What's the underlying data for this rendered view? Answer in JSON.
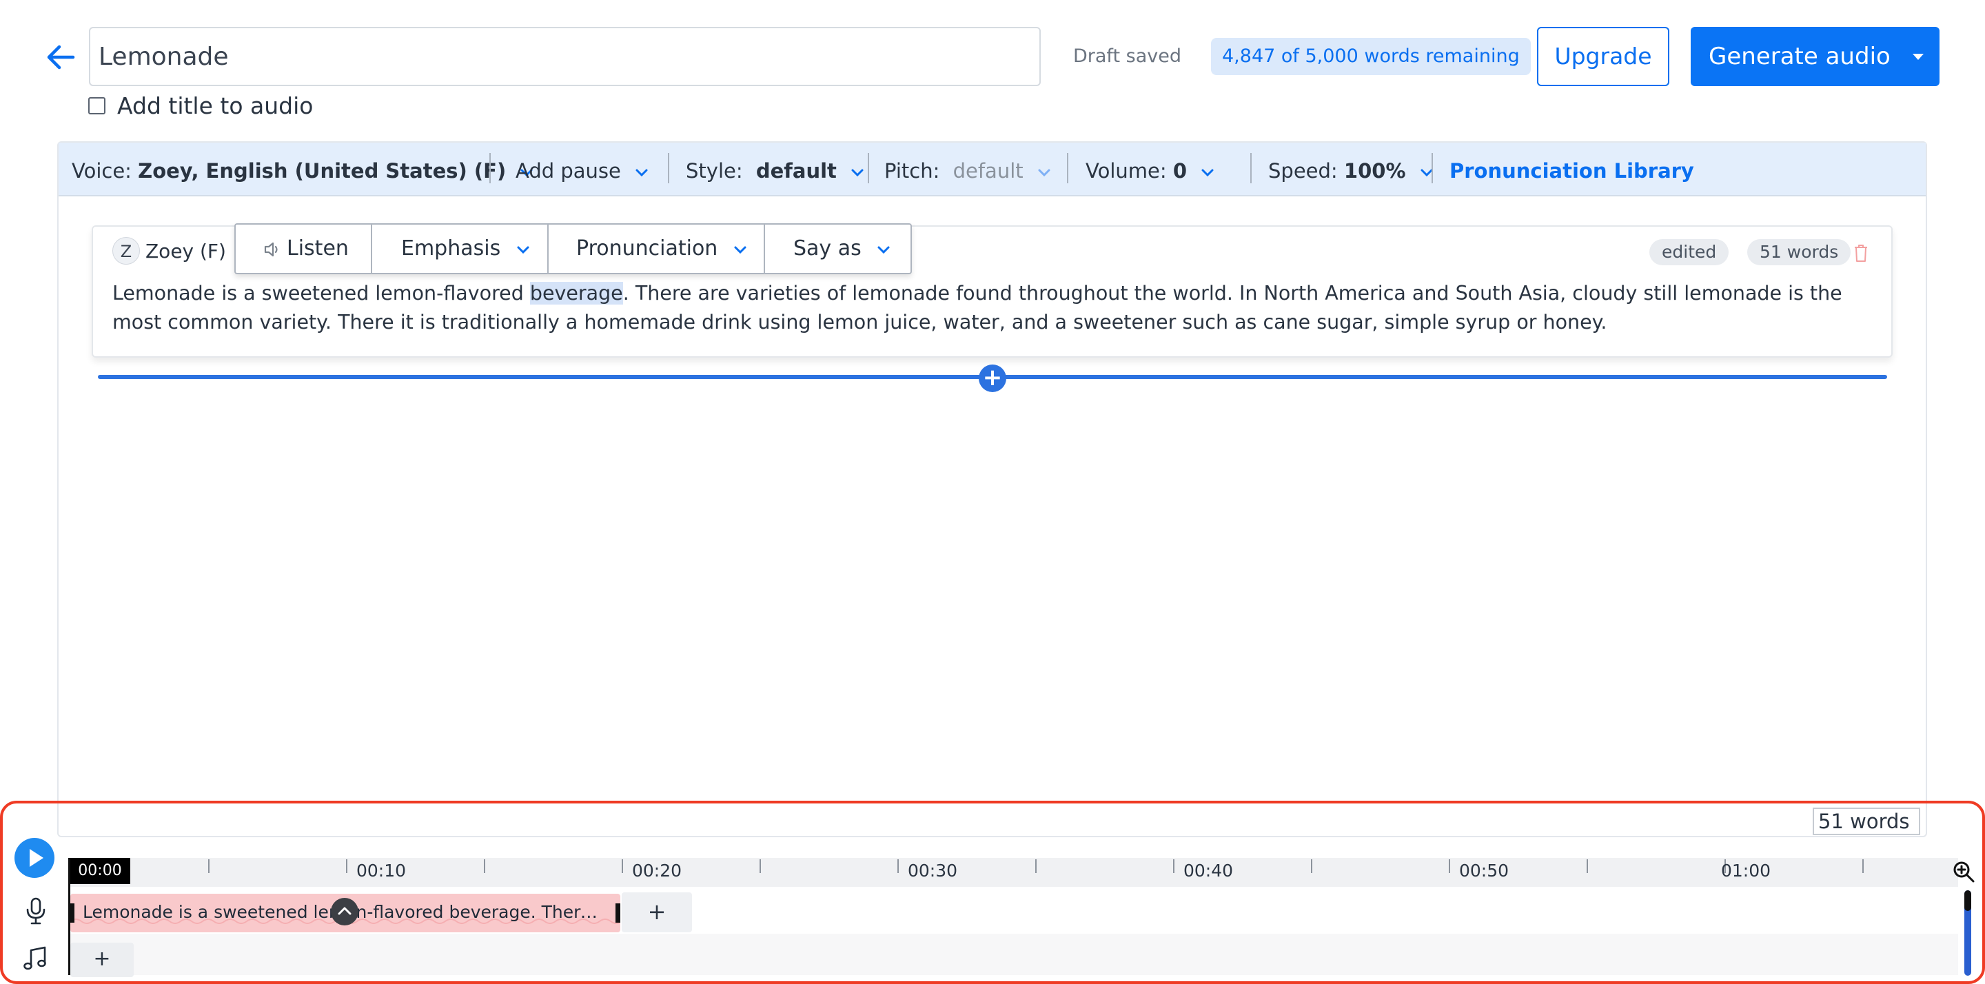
{
  "header": {
    "back_label": "back",
    "title_value": "Lemonade",
    "draft_status": "Draft saved",
    "words_remaining": "4,847 of 5,000 words remaining",
    "upgrade_label": "Upgrade",
    "generate_label": "Generate audio",
    "add_title_label": "Add title to audio"
  },
  "toolbar": {
    "voice_label": "Voice:",
    "voice_value": "Zoey, English (United States) (F)",
    "add_pause": "Add pause",
    "style_label": "Style:",
    "style_value": "default",
    "pitch_label": "Pitch:",
    "pitch_value": "default",
    "volume_label": "Volume:",
    "volume_value": "0",
    "speed_label": "Speed:",
    "speed_value": "100%",
    "pronunciation_library": "Pronunciation Library"
  },
  "block": {
    "voice_initial": "Z",
    "voice_name": "Zoey (F)",
    "listen": "Listen",
    "emphasis": "Emphasis",
    "pronunciation": "Pronunciation",
    "say_as": "Say as",
    "status_badge": "edited",
    "word_badge": "51 words",
    "text_before": "Lemonade is a sweetened lemon-flavored ",
    "text_highlight": "beverage",
    "text_after": ". There are varieties of lemonade found throughout the world. In North America and South Asia, cloudy still lemonade is the most common variety. There it is traditionally a homemade drink using lemon juice, water, and a sweetener such as cane sugar, simple syrup or honey."
  },
  "footer": {
    "word_count": "51 words",
    "current_time": "00:00",
    "time_labels": [
      "00:10",
      "00:20",
      "00:30",
      "00:40",
      "00:50",
      "01:00"
    ],
    "clip_text": "Lemonade is a sweetened lemon-flavored beverage. There are varieties of lemonade found throughout the world.",
    "add_clip": "+",
    "add_music": "+"
  },
  "icons": {
    "back": "arrow-left-icon",
    "chevron": "chevron-down-icon",
    "speaker": "speaker-icon",
    "trash": "trash-icon",
    "play": "play-icon",
    "mic": "microphone-icon",
    "music": "music-note-icon",
    "zoom": "zoom-in-icon"
  },
  "colors": {
    "primary": "#0a74f5",
    "toolbar_bg": "#e3eefc",
    "clip_bg": "#f9c9cb",
    "frame": "#ef3b24"
  }
}
